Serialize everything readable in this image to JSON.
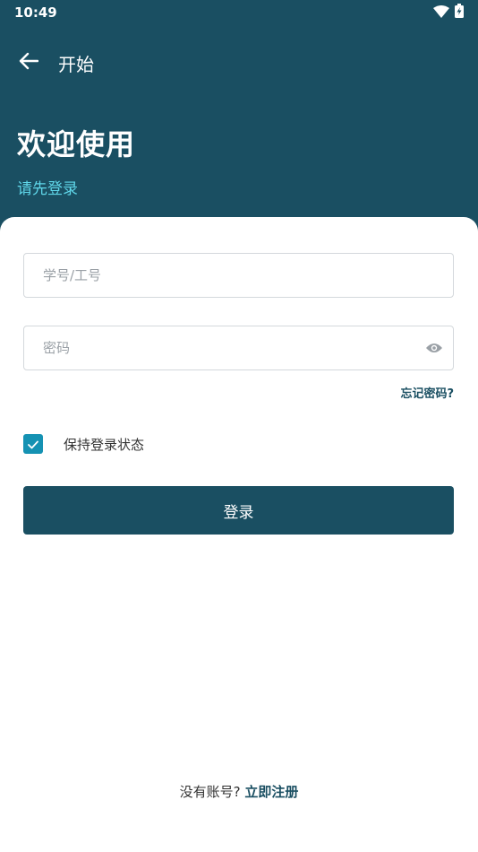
{
  "status_bar": {
    "time": "10:49",
    "icons": [
      "wifi-icon",
      "battery-charging-icon"
    ]
  },
  "app_bar": {
    "back_icon": "arrow-left-icon",
    "title": "开始"
  },
  "hero": {
    "title": "欢迎使用",
    "subtitle": "请先登录"
  },
  "form": {
    "username": {
      "value": "",
      "placeholder": "学号/工号"
    },
    "password": {
      "value": "",
      "placeholder": "密码",
      "toggle_icon": "eye-icon"
    },
    "forgot_label": "忘记密码?",
    "remember": {
      "label": "保持登录状态",
      "checked": true
    },
    "login_label": "登录"
  },
  "footer": {
    "prompt": "没有账号? ",
    "register_label": "立即注册"
  },
  "colors": {
    "primary": "#1a4f62",
    "accent": "#5fd6e9",
    "checkbox": "#1592b3"
  }
}
